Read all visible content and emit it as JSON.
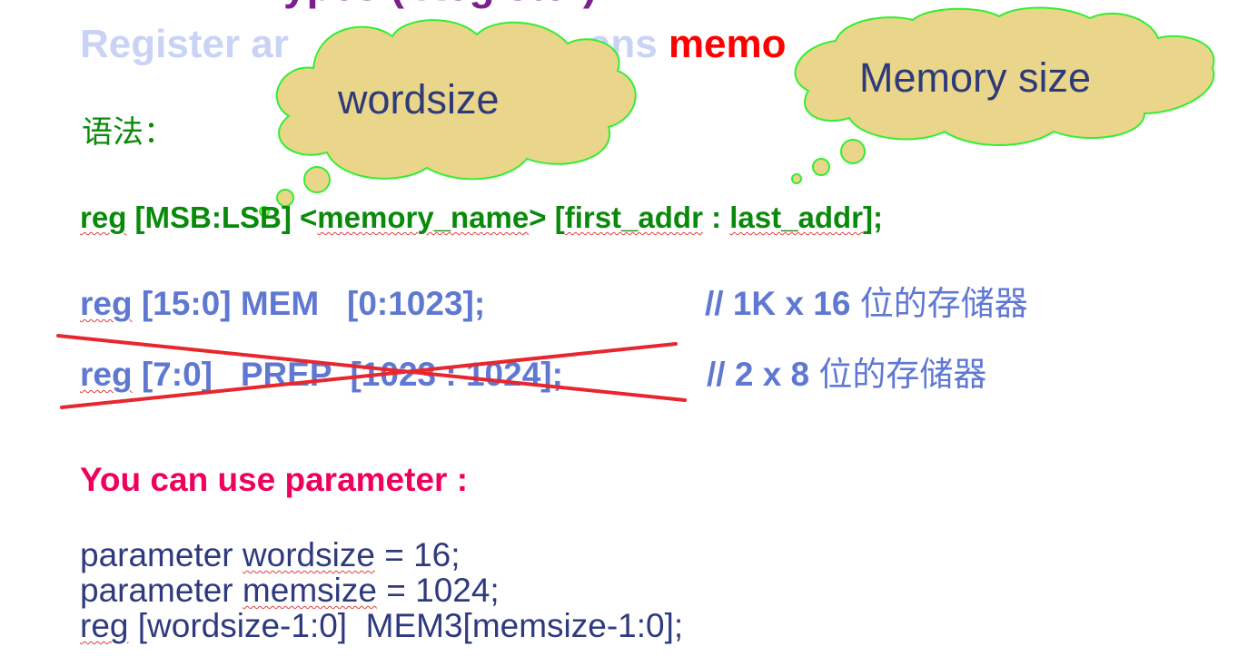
{
  "slide": {
    "title_cut": "ypes ( Register) ",
    "heading": {
      "prefix": "Register ar",
      "middle": "ans ",
      "emphasis": "memo"
    },
    "callouts": {
      "wordsize": "wordsize",
      "memory_size": "Memory size"
    },
    "syntax_label": "语法：",
    "syntax": {
      "kw": "reg",
      "range": "[MSB:LSB]",
      "lt": "<",
      "name": "memory_name",
      "gt": ">",
      "open": "[",
      "first": "first_addr",
      "colon": " : ",
      "last": "last_addr",
      "close": "];"
    },
    "examples": [
      {
        "kw": "reg",
        "code": " [15:0] MEM   [0:1023];",
        "comment_prefix": "// 1K x 16 ",
        "comment_cn": "位的存储器"
      },
      {
        "kw": "reg",
        "code": " [7:0]   PREP  [1023 : 1024];",
        "comment_prefix": "// 2 x 8 ",
        "comment_cn": "位的存储器"
      }
    ],
    "param_heading": "You can use parameter :",
    "param_lines": [
      {
        "pre": "parameter ",
        "squig": "wordsize",
        "post": " = 16;"
      },
      {
        "pre": "parameter ",
        "squig": "memsize",
        "post": " = 1024;"
      },
      {
        "pre": "",
        "squig": "reg",
        "post": " [wordsize-1:0]  MEM3[memsize-1:0];"
      }
    ],
    "colors": {
      "heading_faded": "#c9d3f6",
      "emphasis_red": "#ff0000",
      "syntax_green": "#0a8a0a",
      "code_blue": "#5f78d2",
      "param_pink": "#f0005e",
      "param_navy": "#2f3a7e",
      "bubble_fill": "#ead68a",
      "bubble_stroke": "#33ee33",
      "cross_red": "#e8262e"
    }
  }
}
